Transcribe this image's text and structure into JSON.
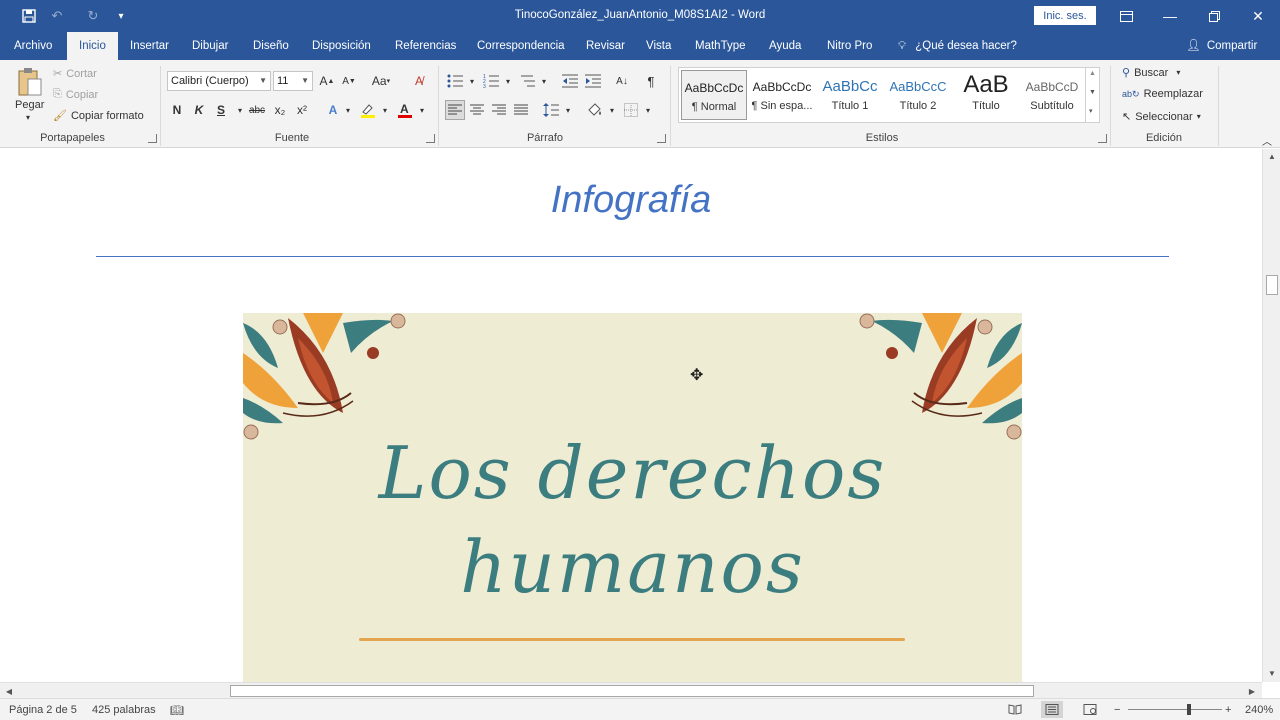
{
  "titlebar": {
    "title": "TinocoGonzález_JuanAntonio_M08S1AI2 - Word",
    "sign_in": "Inic. ses."
  },
  "tabs": [
    {
      "label": "Archivo"
    },
    {
      "label": "Inicio"
    },
    {
      "label": "Insertar"
    },
    {
      "label": "Dibujar"
    },
    {
      "label": "Diseño"
    },
    {
      "label": "Disposición"
    },
    {
      "label": "Referencias"
    },
    {
      "label": "Correspondencia"
    },
    {
      "label": "Revisar"
    },
    {
      "label": "Vista"
    },
    {
      "label": "MathType"
    },
    {
      "label": "Ayuda"
    },
    {
      "label": "Nitro Pro"
    }
  ],
  "tell_me": "¿Qué desea hacer?",
  "share": "Compartir",
  "clipboard": {
    "paste": "Pegar",
    "cut": "Cortar",
    "copy": "Copiar",
    "format_painter": "Copiar formato",
    "group": "Portapapeles"
  },
  "font": {
    "name": "Calibri (Cuerpo)",
    "size": "11",
    "bold": "N",
    "italic": "K",
    "underline": "S",
    "strike": "abc",
    "subscript": "x₂",
    "superscript": "x²",
    "grow": "A",
    "shrink": "A",
    "case": "Aa",
    "group": "Fuente"
  },
  "paragraph": {
    "group": "Párrafo",
    "pilcrow": "¶"
  },
  "styles": {
    "items": [
      {
        "sample": "AaBbCcDc",
        "name": "¶ Normal"
      },
      {
        "sample": "AaBbCcDc",
        "name": "¶ Sin espa..."
      },
      {
        "sample": "AaBbCc",
        "name": "Título 1"
      },
      {
        "sample": "AaBbCcC",
        "name": "Título 2"
      },
      {
        "sample": "AaB",
        "name": "Título"
      },
      {
        "sample": "AaBbCcD",
        "name": "Subtítulo"
      }
    ],
    "group": "Estilos"
  },
  "editing": {
    "find": "Buscar",
    "replace": "Reemplazar",
    "select": "Seleccionar",
    "group": "Edición"
  },
  "document": {
    "heading": "Infografía",
    "infographic_line1": "Los derechos",
    "infographic_line2": "humanos"
  },
  "status": {
    "page": "Página 2 de 5",
    "words": "425 palabras",
    "zoom": "240%"
  },
  "colors": {
    "accent": "#2b579a",
    "heading": "#4472c4",
    "infographic_bg": "#efecd4",
    "script_text": "#3c7d80",
    "underline": "#e5a44f"
  }
}
